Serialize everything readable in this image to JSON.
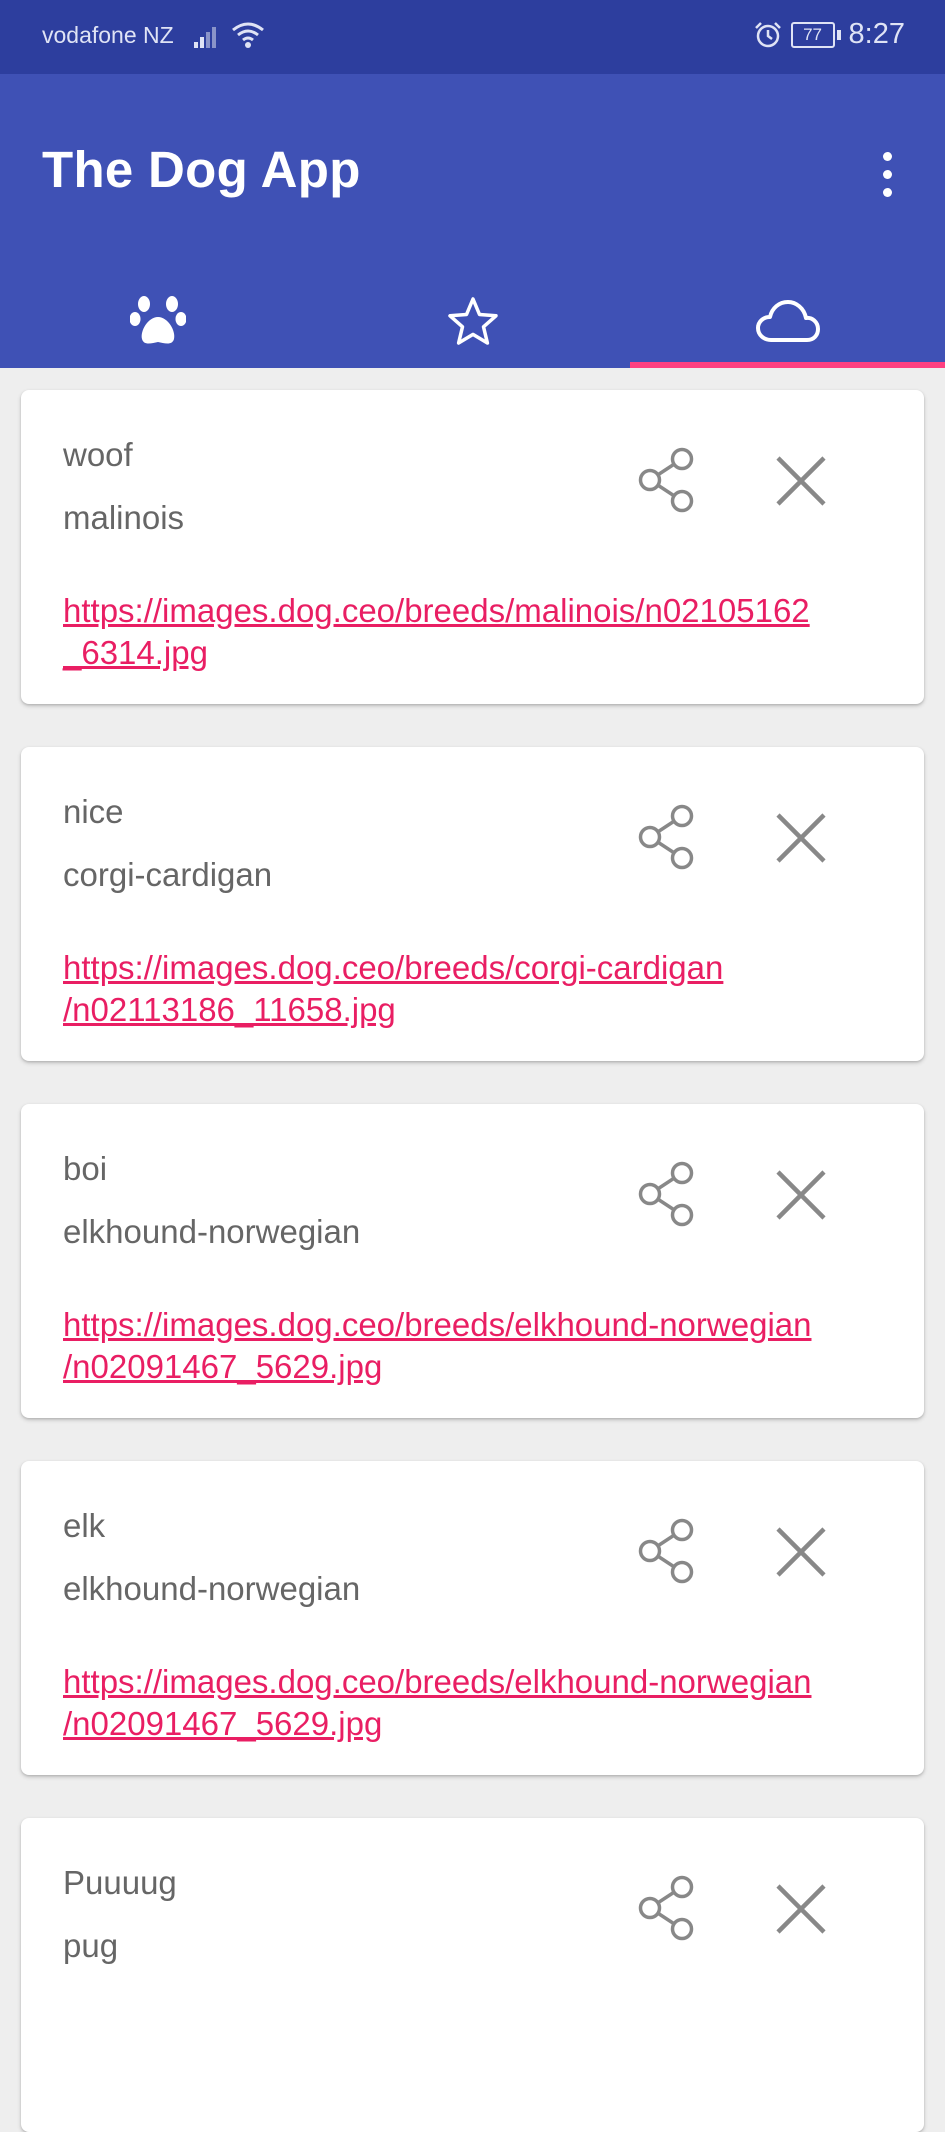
{
  "status_bar": {
    "carrier": "vodafone NZ",
    "battery": "77",
    "time": "8:27"
  },
  "app_bar": {
    "title": "The Dog App"
  },
  "tabs": [
    {
      "icon": "paw-icon",
      "selected": false
    },
    {
      "icon": "star-outline-icon",
      "selected": false
    },
    {
      "icon": "cloud-outline-icon",
      "selected": true
    }
  ],
  "colors": {
    "primary": "#3f51b5",
    "primary_dark": "#2d3e9e",
    "accent": "#ff4081",
    "link": "#e91e63"
  },
  "cards": [
    {
      "name": "woof",
      "breed": "malinois",
      "url": "https://images.dog.ceo/breeds/malinois/n02105162\n_6314.jpg"
    },
    {
      "name": "nice",
      "breed": "corgi-cardigan",
      "url": "https://images.dog.ceo/breeds/corgi-cardigan\n/n02113186_11658.jpg"
    },
    {
      "name": "boi",
      "breed": "elkhound-norwegian",
      "url": "https://images.dog.ceo/breeds/elkhound-norwegian\n/n02091467_5629.jpg"
    },
    {
      "name": "elk",
      "breed": "elkhound-norwegian",
      "url": "https://images.dog.ceo/breeds/elkhound-norwegian\n/n02091467_5629.jpg"
    },
    {
      "name": "Puuuug",
      "breed": "pug",
      "url": ""
    }
  ]
}
